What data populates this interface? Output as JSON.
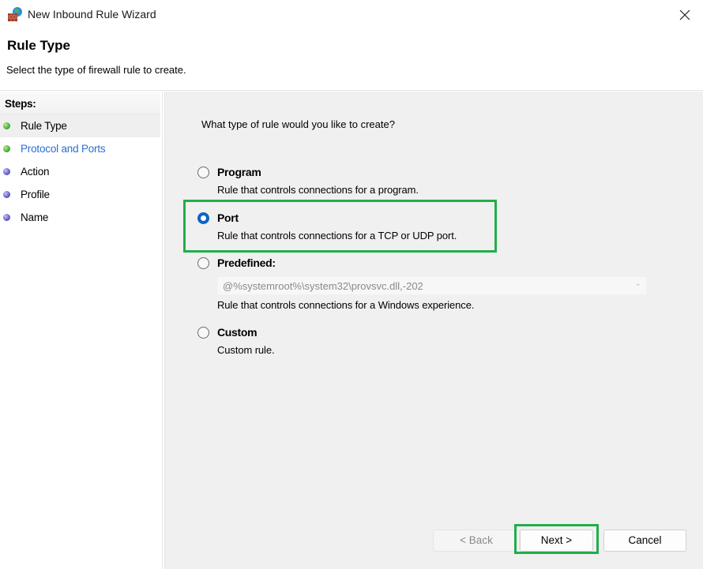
{
  "window": {
    "title": "New Inbound Rule Wizard",
    "icon": "firewall-globe-icon",
    "close_icon": "close-icon"
  },
  "header": {
    "title": "Rule Type",
    "subtitle": "Select the type of firewall rule to create."
  },
  "steps": {
    "heading": "Steps:",
    "items": [
      {
        "label": "Rule Type",
        "status": "done",
        "active": true
      },
      {
        "label": "Protocol and Ports",
        "status": "done",
        "active": false
      },
      {
        "label": "Action",
        "status": "todo",
        "active": false
      },
      {
        "label": "Profile",
        "status": "todo",
        "active": false
      },
      {
        "label": "Name",
        "status": "todo",
        "active": false
      }
    ]
  },
  "main": {
    "question": "What type of rule would you like to create?",
    "options": [
      {
        "label": "Program",
        "description": "Rule that controls connections for a program.",
        "selected": false
      },
      {
        "label": "Port",
        "description": "Rule that controls connections for a TCP or UDP port.",
        "selected": true
      },
      {
        "label": "Predefined:",
        "description": "Rule that controls connections for a Windows experience.",
        "selected": false
      },
      {
        "label": "Custom",
        "description": "Custom rule.",
        "selected": false
      }
    ],
    "predefined_combo": {
      "value": "@%systemroot%\\system32\\provsvc.dll,-202",
      "enabled": false
    }
  },
  "buttons": {
    "back": "< Back",
    "next": "Next >",
    "cancel": "Cancel"
  },
  "colors": {
    "highlight": "#22ad4b",
    "radio_selected": "#0a64c8",
    "link": "#2a6fd1"
  }
}
